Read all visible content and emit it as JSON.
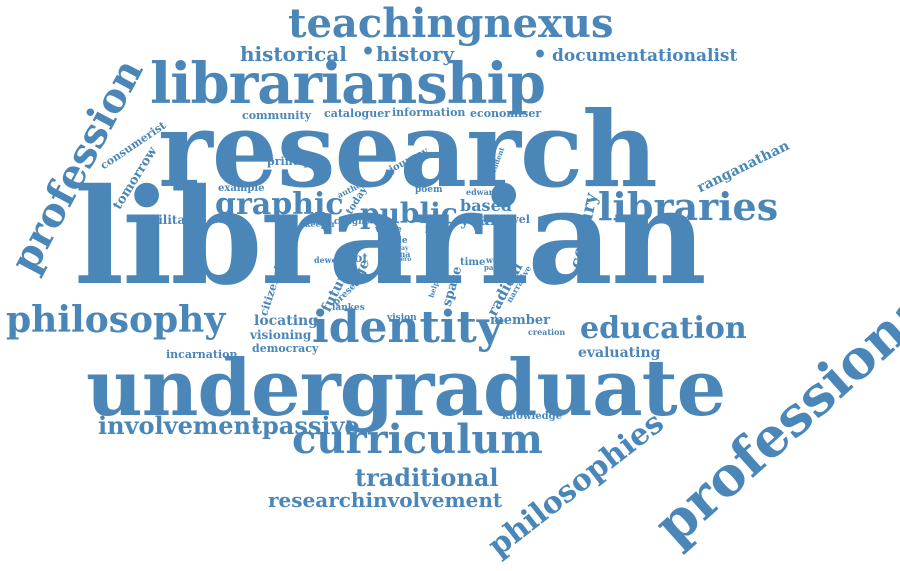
{
  "colors": {
    "word": "#4a86b8",
    "background": "#ffffff"
  },
  "words": {
    "librarian": "librarian",
    "research": "research",
    "undergraduate": "undergraduate",
    "librarianship": "librarianship",
    "teachingnexus": "teachingnexus",
    "professional": "professional",
    "profession": "profession",
    "identity": "identity",
    "curriculum": "curriculum",
    "philosophy": "philosophy",
    "philosophies": "philosophies",
    "libraries": "libraries",
    "education": "education",
    "graphic": "graphic",
    "public": "public",
    "involvement": "involvement",
    "passive": "passive",
    "traditional": "traditional",
    "researchinvolvement": "researchinvolvement",
    "historical": "historical",
    "history": "history",
    "documentationalist": "documentationalist",
    "community": "community",
    "cataloguer": "cataloguer",
    "information": "information",
    "economiser": "economiser",
    "consumerist": "consumerist",
    "tomorrow": "tomorrow",
    "principle": "principle",
    "journey": "journey",
    "student": "student",
    "ranganathan": "ranganathan",
    "example": "example",
    "author": "author",
    "today": "today",
    "poem": "poem",
    "edward": "edward",
    "based": "based",
    "year": "year",
    "novel": "novel",
    "century": "century",
    "facilitator": "facilitator",
    "keeper": "keeper",
    "caught": "caught",
    "value": "value",
    "style": "style",
    "book": "book",
    "shift": "shift",
    "dewey": "dewey",
    "root": "root",
    "age": "age",
    "way": "way",
    "arena": "arena",
    "hero": "hero",
    "future": "future",
    "present": "present",
    "lankes": "lankes",
    "helper": "helper",
    "space": "space",
    "time": "time",
    "work": "work",
    "paper": "paper",
    "radical": "radical",
    "narrative": "narrative",
    "citizenship": "citizenship",
    "locating": "locating",
    "vision": "vision",
    "member": "member",
    "creation": "creation",
    "visioning": "visioning",
    "democracy": "democracy",
    "incarnation": "incarnation",
    "evaluating": "evaluating",
    "knowledge": "knowledge"
  }
}
